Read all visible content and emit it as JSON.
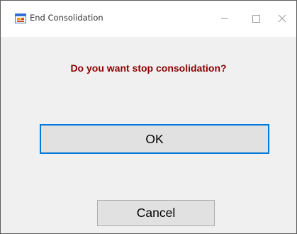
{
  "window": {
    "title": "End Consolidation",
    "icon": "windows-form-icon",
    "controls": {
      "minimize": "minimize-icon",
      "maximize": "maximize-icon",
      "close": "close-icon"
    }
  },
  "dialog": {
    "question": "Do you want stop consolidation?",
    "ok_label": "OK",
    "cancel_label": "Cancel"
  },
  "colors": {
    "question_text": "#8b0000",
    "focus_border": "#0078d7",
    "button_face": "#e1e1e1",
    "dialog_background": "#f0f0f0"
  }
}
